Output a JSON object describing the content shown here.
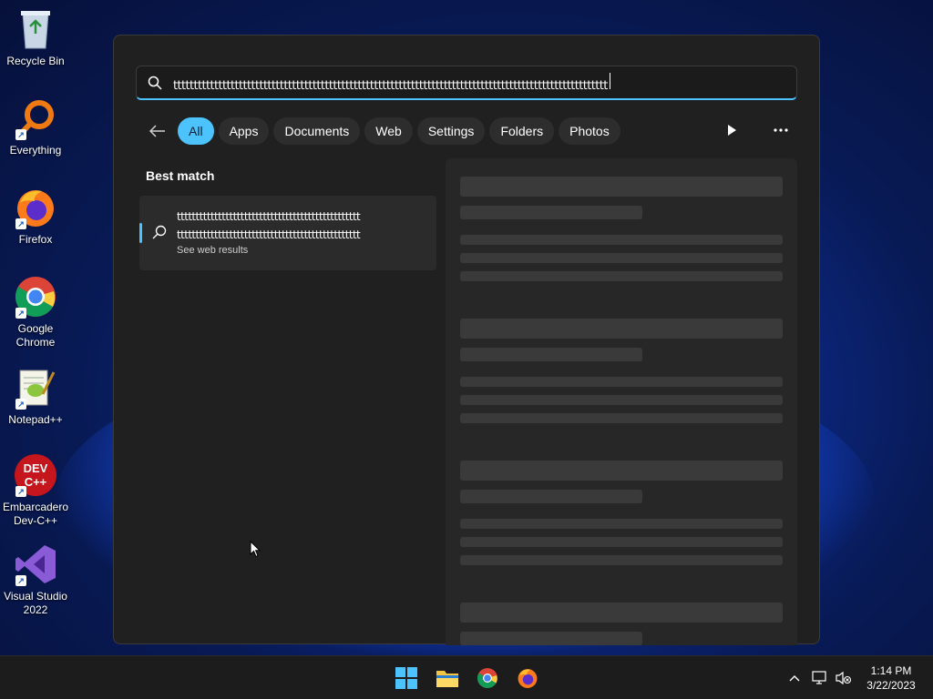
{
  "desktop": {
    "icons": [
      {
        "label": "Recycle Bin",
        "icon": "recycle-bin-icon"
      },
      {
        "label": "Everything",
        "icon": "everything-icon"
      },
      {
        "label": "Firefox",
        "icon": "firefox-icon"
      },
      {
        "label": "Google Chrome",
        "icon": "chrome-icon"
      },
      {
        "label": "Notepad++",
        "icon": "notepad-plus-plus-icon"
      },
      {
        "label": "Embarcadero Dev-C++",
        "icon": "dev-cpp-icon"
      },
      {
        "label": "Visual Studio 2022",
        "icon": "visual-studio-icon"
      }
    ]
  },
  "search": {
    "query": "tttttttttttttttttttttttttttttttttttttttttttttttttttttttttttttttttttttttttttttttttttttttttttttttttttttttttt",
    "filters": [
      "All",
      "Apps",
      "Documents",
      "Web",
      "Settings",
      "Folders",
      "Photos"
    ],
    "active_filter": "All",
    "best_match_label": "Best match",
    "result": {
      "line1": "ttttttttttttttttttttttttttttttttttttttttttttttttt",
      "line2": "ttttttttttttttttttttttttttttttttttttttttttttttttt",
      "subtitle": "See web results"
    }
  },
  "taskbar": {
    "pinned": [
      "start-icon",
      "file-explorer-icon",
      "chrome-icon",
      "firefox-icon"
    ],
    "time": "1:14 PM",
    "date": "3/22/2023"
  },
  "colors": {
    "accent": "#4cc2ff",
    "panel": "#202020",
    "taskbar": "#1c1c1c"
  }
}
